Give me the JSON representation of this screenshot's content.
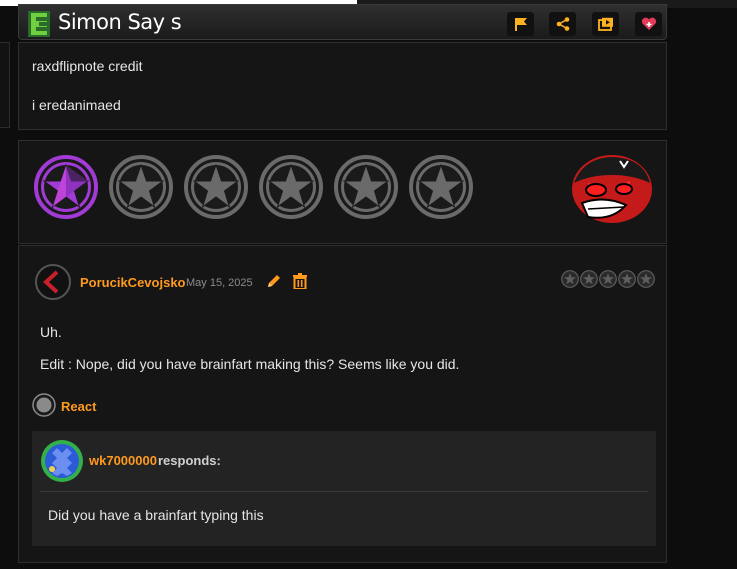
{
  "header": {
    "title": "Simon Say s",
    "buttons": [
      {
        "name": "flag-button",
        "icon": "flag-icon"
      },
      {
        "name": "share-button",
        "icon": "share-icon"
      },
      {
        "name": "playlist-button",
        "icon": "playlist-icon"
      },
      {
        "name": "favorite-button",
        "icon": "heart-icon"
      }
    ]
  },
  "description": {
    "line1": "raxdflipnote credit",
    "line2": "i eredanimaed"
  },
  "rating": {
    "value": 1,
    "max": 6,
    "active_color": "#a23ad6",
    "inactive_color": "#6a6a6a"
  },
  "review": {
    "author": "PorucikCevojsko",
    "date": "May 15, 2025",
    "score": 0,
    "score_max": 5,
    "body_line1": "Uh.",
    "body_line2": "Edit : Nope, did you have brainfart making this? Seems like you did.",
    "react_label": "React",
    "response": {
      "author": "wk7000000",
      "suffix": "responds:",
      "text": "Did you have a brainfart typing this"
    }
  },
  "colors": {
    "accent": "#ff9a1f",
    "background": "#0d0d0d",
    "panel": "#151515"
  }
}
